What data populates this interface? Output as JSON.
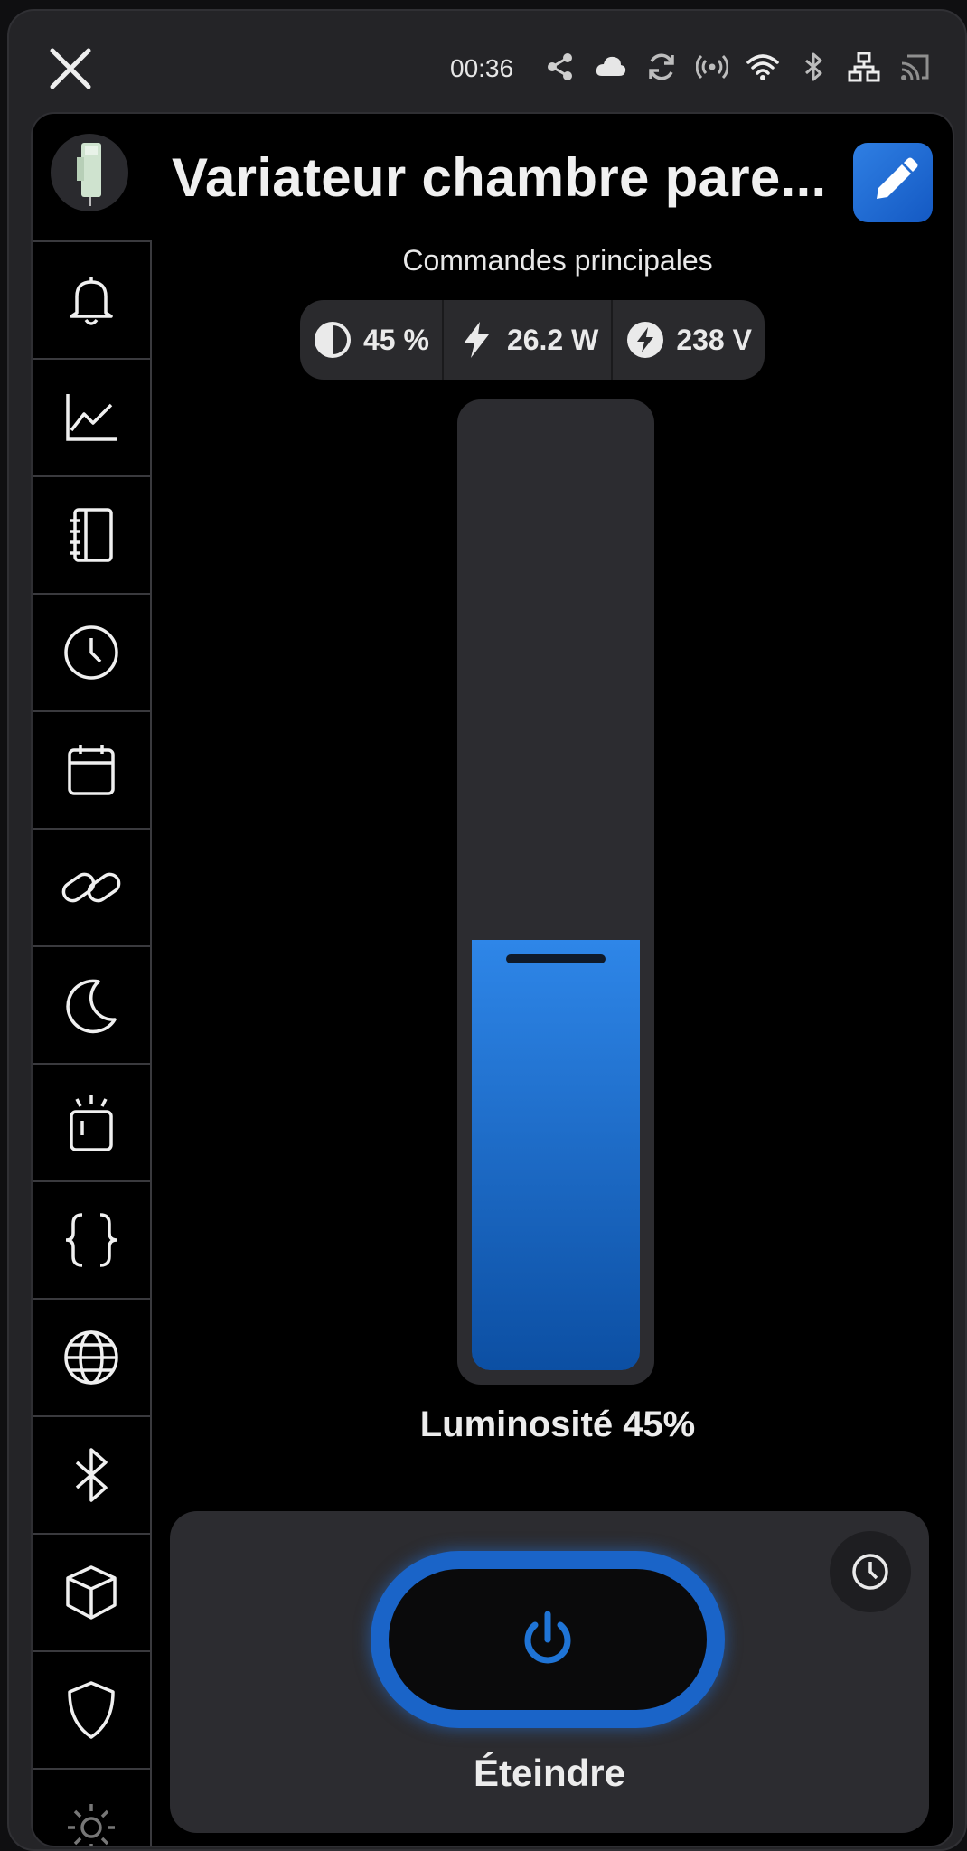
{
  "statusbar": {
    "time": "00:36",
    "icons": [
      "share-icon",
      "cloud-icon",
      "sync-icon",
      "broadcast-icon",
      "wifi-icon",
      "bluetooth-icon",
      "network-icon",
      "cast-icon"
    ]
  },
  "header": {
    "title": "Variateur chambre pare...",
    "edit_icon": "pencil-icon"
  },
  "sidebar": {
    "items": [
      {
        "name": "bell"
      },
      {
        "name": "chart"
      },
      {
        "name": "notebook"
      },
      {
        "name": "clock"
      },
      {
        "name": "calendar"
      },
      {
        "name": "link"
      },
      {
        "name": "moon"
      },
      {
        "name": "scene"
      },
      {
        "name": "code-braces"
      },
      {
        "name": "globe"
      },
      {
        "name": "bluetooth"
      },
      {
        "name": "cube"
      },
      {
        "name": "shield"
      },
      {
        "name": "settings"
      }
    ]
  },
  "main": {
    "section_title": "Commandes principales",
    "chips": [
      {
        "icon": "contrast-icon",
        "value": "45 %"
      },
      {
        "icon": "lightning-icon",
        "value": "26.2 W"
      },
      {
        "icon": "voltage-icon",
        "value": "238 V"
      }
    ],
    "brightness": {
      "level_fraction": 0.45,
      "caption": "Luminosité 45%"
    },
    "power": {
      "label": "Éteindre",
      "timer_icon": "clock-icon"
    }
  },
  "colors": {
    "accent": "#1a64c8",
    "fill_top": "#2e86e8",
    "fill_bottom": "#0c4fa3",
    "panel_bg": "#000000",
    "frame_bg": "#242427"
  }
}
